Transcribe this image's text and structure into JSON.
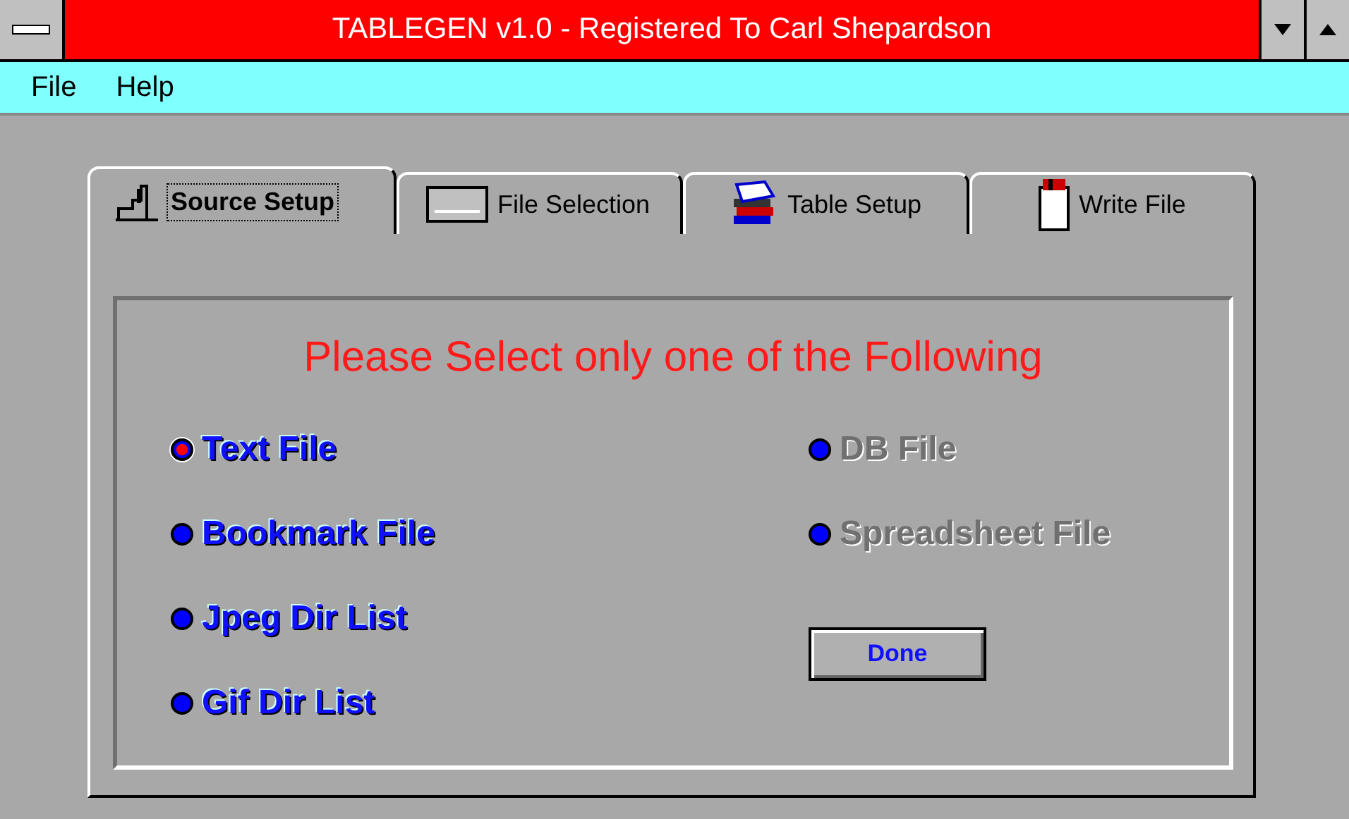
{
  "window": {
    "title": "TABLEGEN v1.0 - Registered To Carl Shepardson"
  },
  "menu": [
    "File",
    "Help"
  ],
  "tabs": [
    {
      "label": "Source Setup",
      "selected": true
    },
    {
      "label": "File Selection",
      "selected": false
    },
    {
      "label": "Table Setup",
      "selected": false
    },
    {
      "label": "Write File",
      "selected": false
    }
  ],
  "panel": {
    "heading": "Please Select only one of the Following",
    "left_options": [
      {
        "label": "Text File",
        "selected": true,
        "disabled": false
      },
      {
        "label": "Bookmark File",
        "selected": false,
        "disabled": false
      },
      {
        "label": "Jpeg Dir List",
        "selected": false,
        "disabled": false
      },
      {
        "label": "Gif Dir List",
        "selected": false,
        "disabled": false
      }
    ],
    "right_options": [
      {
        "label": "DB File",
        "selected": false,
        "disabled": true
      },
      {
        "label": "Spreadsheet File",
        "selected": false,
        "disabled": true
      }
    ],
    "button": "Done"
  }
}
